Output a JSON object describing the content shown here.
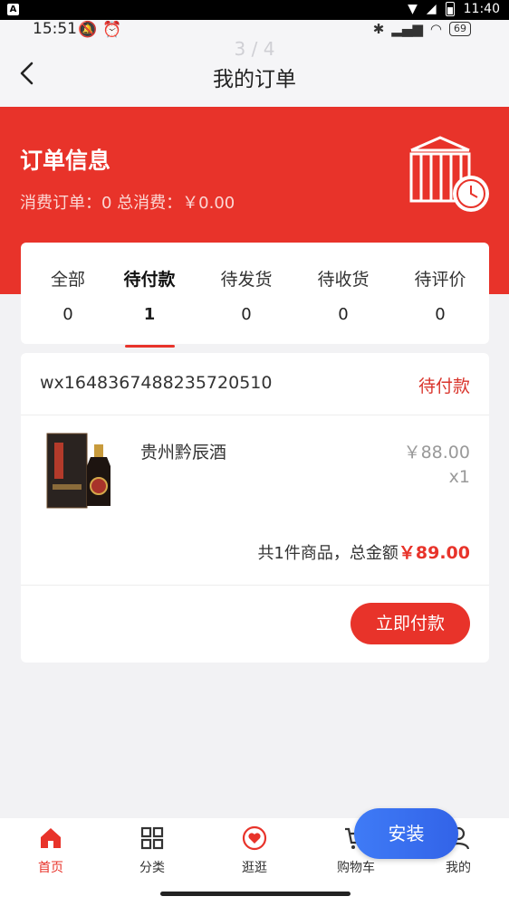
{
  "system": {
    "badge": "A",
    "clock": "11:40"
  },
  "status": {
    "time": "15:51",
    "battery": "69",
    "pager": "3 / 4"
  },
  "nav": {
    "title": "我的订单"
  },
  "hero": {
    "title": "订单信息",
    "summary": "消费订单：0 总消费：￥0.00"
  },
  "tabs": [
    {
      "label": "全部",
      "count": "0"
    },
    {
      "label": "待付款",
      "count": "1"
    },
    {
      "label": "待发货",
      "count": "0"
    },
    {
      "label": "待收货",
      "count": "0"
    },
    {
      "label": "待评价",
      "count": "0"
    }
  ],
  "order": {
    "number": "wx1648367488235720510",
    "status": "待付款",
    "product_name": "贵州黔辰酒",
    "price": "￥88.00",
    "quantity": "x1",
    "total_prefix": "共1件商品，总金额",
    "total_amount": "￥89.00",
    "pay_label": "立即付款"
  },
  "bottom_nav": [
    {
      "label": "首页",
      "icon": "home-icon"
    },
    {
      "label": "分类",
      "icon": "grid-icon"
    },
    {
      "label": "逛逛",
      "icon": "heart-icon"
    },
    {
      "label": "购物车",
      "icon": "cart-icon"
    },
    {
      "label": "我的",
      "icon": "user-icon"
    }
  ],
  "install_label": "安装",
  "colors": {
    "accent": "#e8332a",
    "install": "#3f7bf6"
  }
}
